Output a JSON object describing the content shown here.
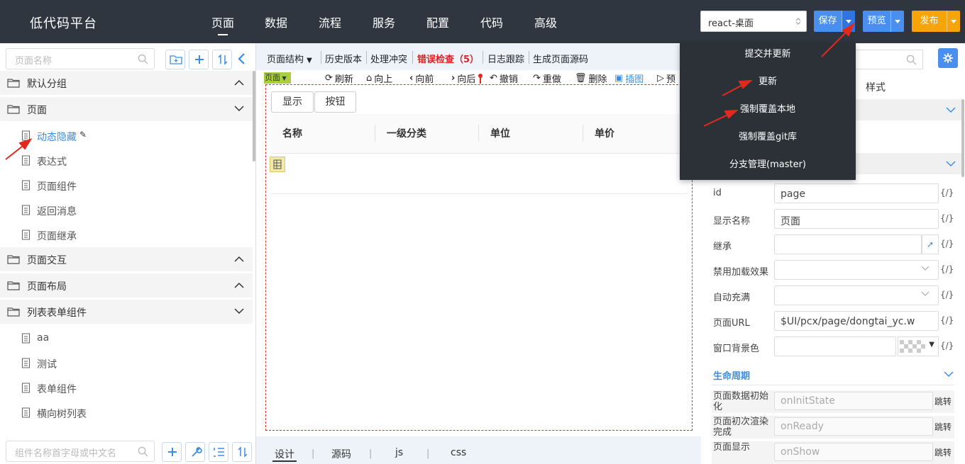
{
  "app": {
    "title": "低代码平台"
  },
  "nav": [
    "页面",
    "数据",
    "流程",
    "服务",
    "配置",
    "代码",
    "高级"
  ],
  "env_select": {
    "value": "react-桌面"
  },
  "actions": {
    "save": "保存",
    "preview": "预览",
    "publish": "发布"
  },
  "colors": {
    "topbar": "#2f3640",
    "save": "#4a8ff0",
    "preview": "#4a8ff0",
    "publish": "#f5a50a",
    "accent": "#3a8ee6",
    "error": "#e02020"
  },
  "save_menu": [
    "提交并更新",
    "更新",
    "强制覆盖本地",
    "强制覆盖git库",
    "分支管理(master)"
  ],
  "left": {
    "search_placeholder": "页面名称",
    "tree": [
      {
        "type": "group",
        "label": "默认分组",
        "open": false
      },
      {
        "type": "group",
        "label": "页面",
        "open": true
      },
      {
        "type": "item",
        "label": "动态隐藏",
        "selected": true
      },
      {
        "type": "item",
        "label": "表达式"
      },
      {
        "type": "item",
        "label": "页面组件"
      },
      {
        "type": "item",
        "label": "返回消息"
      },
      {
        "type": "item",
        "label": "页面继承"
      },
      {
        "type": "group",
        "label": "页面交互",
        "open": false
      },
      {
        "type": "group",
        "label": "页面布局",
        "open": false
      },
      {
        "type": "group",
        "label": "列表表单组件",
        "open": true
      },
      {
        "type": "item",
        "label": "aa"
      },
      {
        "type": "item",
        "label": "测试"
      },
      {
        "type": "item",
        "label": "表单组件"
      },
      {
        "type": "item",
        "label": "横向树列表"
      }
    ],
    "component_search_placeholder": "组件名称首字母或中文名"
  },
  "center": {
    "toolbar": {
      "structure": "页面结构",
      "history": "历史版本",
      "conflict": "处理冲突",
      "error_check": "错误检查（5）",
      "log": "日志跟踪",
      "gen_source": "生成页面源码"
    },
    "toolbar2": {
      "refresh": "刷新",
      "up": "向上",
      "prev": "向前",
      "next": "向后",
      "undo": "撤销",
      "redo": "重做",
      "delete": "删除",
      "screenshot": "插图",
      "preview_short": "预"
    },
    "page_badge": "页面",
    "buttons": [
      "显示",
      "按钮"
    ],
    "table_headers": [
      "名称",
      "一级分类",
      "单位",
      "单价"
    ],
    "bottom_tabs": [
      "设计",
      "源码",
      "js",
      "css"
    ]
  },
  "right": {
    "style_tab": "样式",
    "props": [
      {
        "label": "id",
        "value": "page"
      },
      {
        "label": "显示名称",
        "value": "页面"
      },
      {
        "label": "继承",
        "value": ""
      },
      {
        "label": "禁用加载效果",
        "value": ""
      },
      {
        "label": "自动充满",
        "value": ""
      },
      {
        "label": "页面URL",
        "value": "$UI/pcx/page/dongtai_yc.w"
      },
      {
        "label": "窗口背景色",
        "value": ""
      }
    ],
    "fx": "{/}",
    "lifecycle_title": "生命周期",
    "lifecycle": [
      {
        "label": "页面数据初始化",
        "value": "onInitState"
      },
      {
        "label": "页面初次渲染完成",
        "value": "onReady"
      },
      {
        "label": "页面显示",
        "value": "onShow"
      }
    ],
    "jump": "跳转"
  }
}
